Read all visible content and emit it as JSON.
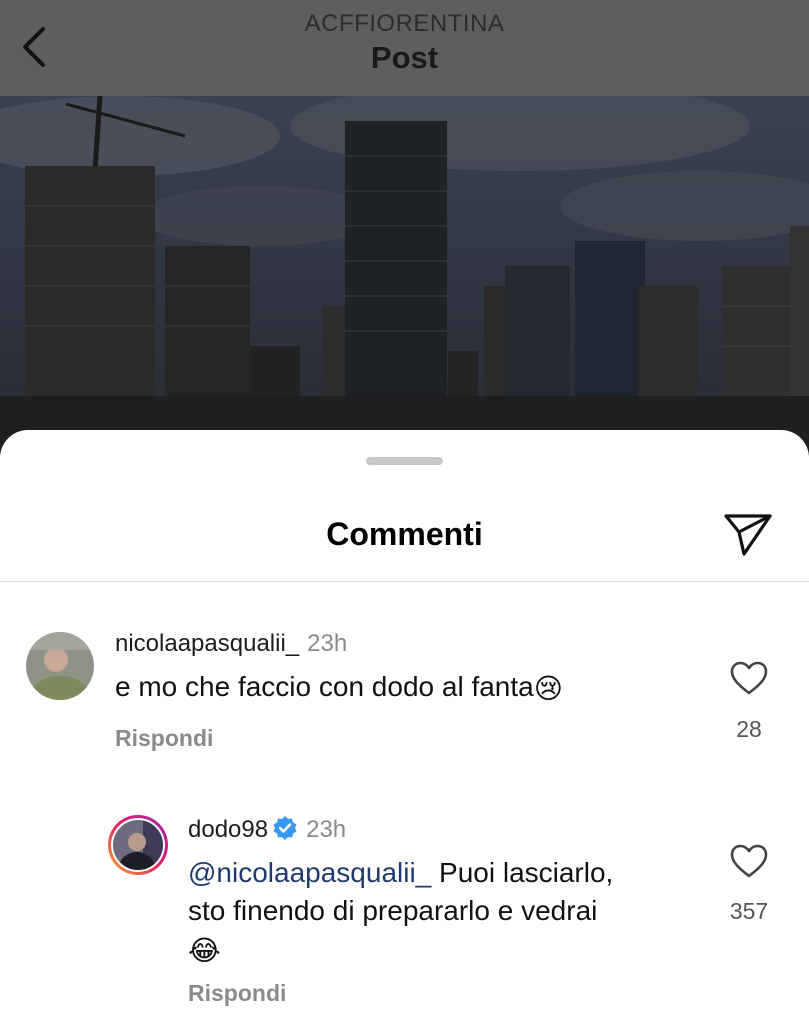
{
  "header": {
    "account": "ACFFIORENTINA",
    "title": "Post"
  },
  "sheet": {
    "title": "Commenti"
  },
  "comments": [
    {
      "username": "nicolaapasqualii_",
      "time": "23h",
      "text": "e mo che faccio con dodo al fanta",
      "emoji": "😢",
      "reply_label": "Rispondi",
      "likes": "28"
    },
    {
      "username": "dodo98",
      "verified": true,
      "time": "23h",
      "mention": "@nicolaapasqualii_",
      "text_line1": " Puoi lasciarlo,",
      "text_line2": "sto finendo di prepararlo e vedrai",
      "emoji": "😂",
      "reply_label": "Rispondi",
      "likes": "357"
    }
  ],
  "colors": {
    "header_bg": "#5e5e5e",
    "verified_blue": "#3897f0",
    "mention": "#1f3a6e",
    "muted": "#8a8a8a"
  }
}
